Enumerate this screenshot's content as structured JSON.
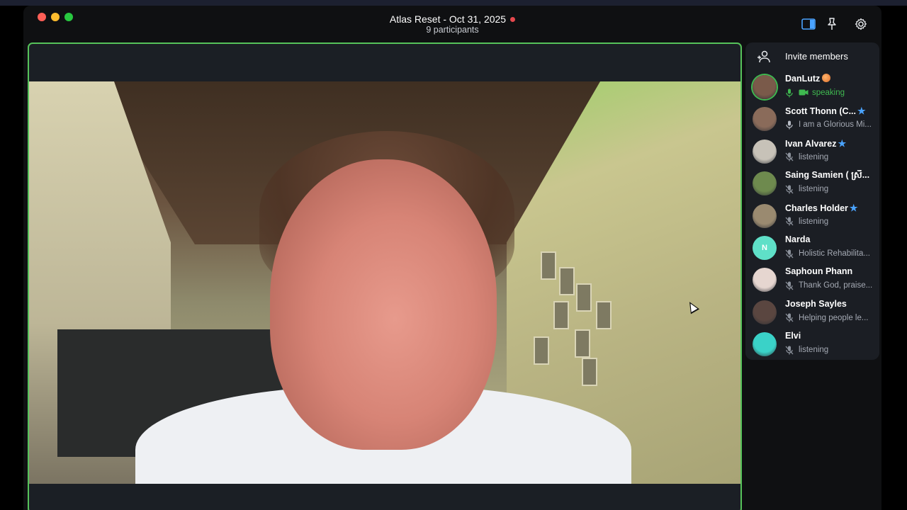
{
  "window": {
    "title": "Atlas Reset - Oct 31, 2025",
    "subtitle": "9 participants"
  },
  "colors": {
    "speaking_border": "#56c25a",
    "recording_dot": "#e5484d",
    "star": "#4aa3ff",
    "speaking_status": "#3fb950"
  },
  "toolbar": {
    "icons": [
      "sidebar-toggle-icon",
      "pin-icon",
      "gear-icon"
    ]
  },
  "sidebar": {
    "invite_label": "Invite members",
    "participants": [
      {
        "name": "DanLutz",
        "status": "speaking",
        "muted": false,
        "video": true,
        "starred": false,
        "emoji": "peach",
        "avatar_color": "#7a5a4a"
      },
      {
        "name": "Scott Thonn (C...",
        "status": "I am a Glorious Mi...",
        "muted": false,
        "video": false,
        "starred": true,
        "avatar_color": "#8a6b5a"
      },
      {
        "name": "Ivan Alvarez",
        "status": "listening",
        "muted": true,
        "video": false,
        "starred": true,
        "avatar_color": "#c7c2b8"
      },
      {
        "name": "Saing Samien ( ស្រី...",
        "status": "listening",
        "muted": true,
        "video": false,
        "starred": false,
        "avatar_color": "#6e8a4e"
      },
      {
        "name": "Charles Holder",
        "status": "listening",
        "muted": true,
        "video": false,
        "starred": true,
        "avatar_color": "#9a8a70"
      },
      {
        "name": "Narda",
        "status": "Holistic Rehabilita...",
        "muted": true,
        "video": false,
        "starred": false,
        "avatar_color": "#5fe0c8",
        "initial": "N"
      },
      {
        "name": "Saphoun Phann",
        "status": "Thank God, praise...",
        "muted": true,
        "video": false,
        "starred": false,
        "avatar_color": "#e6d6d0"
      },
      {
        "name": "Joseph Sayles",
        "status": "Helping people le...",
        "muted": true,
        "video": false,
        "starred": false,
        "avatar_color": "#5a4640"
      },
      {
        "name": "Elvi",
        "status": "listening",
        "muted": true,
        "video": false,
        "starred": false,
        "avatar_color": "#3ad2c8"
      }
    ]
  }
}
